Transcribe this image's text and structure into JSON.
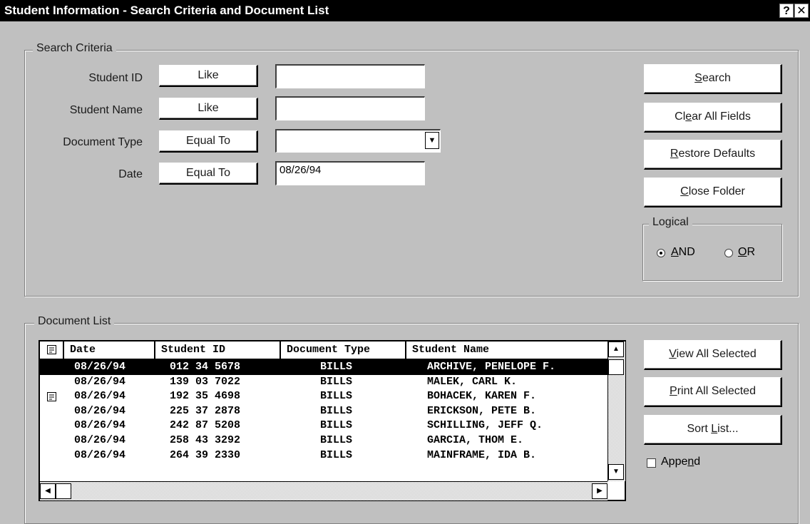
{
  "window": {
    "title": "Student Information - Search Criteria and Document List",
    "help_glyph": "?",
    "close_glyph": "✕"
  },
  "search": {
    "legend": "Search Criteria",
    "fields": [
      {
        "label": "Student ID",
        "operator": "Like",
        "value": ""
      },
      {
        "label": "Student Name",
        "operator": "Like",
        "value": ""
      },
      {
        "label": "Document Type",
        "operator": "Equal To",
        "value": ""
      },
      {
        "label": "Date",
        "operator": "Equal To",
        "value": "08/26/94"
      }
    ]
  },
  "buttons": {
    "search": {
      "mn": "S",
      "rest": "earch"
    },
    "clear": {
      "pre": "Cl",
      "mn": "e",
      "rest": "ar All Fields"
    },
    "restore": {
      "mn": "R",
      "rest": "estore Defaults"
    },
    "close": {
      "mn": "C",
      "rest": "lose Folder"
    },
    "view": {
      "mn": "V",
      "rest": "iew All Selected"
    },
    "print": {
      "mn": "P",
      "rest": "rint All Selected"
    },
    "sort": {
      "pre": "Sort ",
      "mn": "L",
      "rest": "ist..."
    }
  },
  "logical": {
    "legend": "Logical",
    "and": {
      "mn": "A",
      "rest": "ND",
      "selected": true
    },
    "or": {
      "mn": "O",
      "rest": "R",
      "selected": false
    }
  },
  "doclist": {
    "legend": "Document List",
    "columns": [
      "Date",
      "Student ID",
      "Document Type",
      "Student Name"
    ],
    "rows": [
      {
        "note": false,
        "date": "08/26/94",
        "id": "012 34 5678",
        "type": "BILLS",
        "name": "ARCHIVE, PENELOPE F.",
        "selected": true
      },
      {
        "note": false,
        "date": "08/26/94",
        "id": "139 03 7022",
        "type": "BILLS",
        "name": "MALEK, CARL K.",
        "selected": false
      },
      {
        "note": true,
        "date": "08/26/94",
        "id": "192 35 4698",
        "type": "BILLS",
        "name": "BOHACEK, KAREN F.",
        "selected": false
      },
      {
        "note": false,
        "date": "08/26/94",
        "id": "225 37 2878",
        "type": "BILLS",
        "name": "ERICKSON, PETE B.",
        "selected": false
      },
      {
        "note": false,
        "date": "08/26/94",
        "id": "242 87 5208",
        "type": "BILLS",
        "name": "SCHILLING, JEFF Q.",
        "selected": false
      },
      {
        "note": false,
        "date": "08/26/94",
        "id": "258 43 3292",
        "type": "BILLS",
        "name": "GARCIA, THOM E.",
        "selected": false
      },
      {
        "note": false,
        "date": "08/26/94",
        "id": "264 39 2330",
        "type": "BILLS",
        "name": "MAINFRAME, IDA B.",
        "selected": false
      }
    ]
  },
  "append": {
    "pre": "Appe",
    "mn": "n",
    "rest": "d",
    "checked": false
  },
  "icons": {
    "note": "note-icon",
    "scroll_up": "arrow-up-icon",
    "scroll_down": "arrow-down-icon",
    "scroll_left": "arrow-left-icon",
    "scroll_right": "arrow-right-icon",
    "combo": "chevron-down-icon"
  }
}
